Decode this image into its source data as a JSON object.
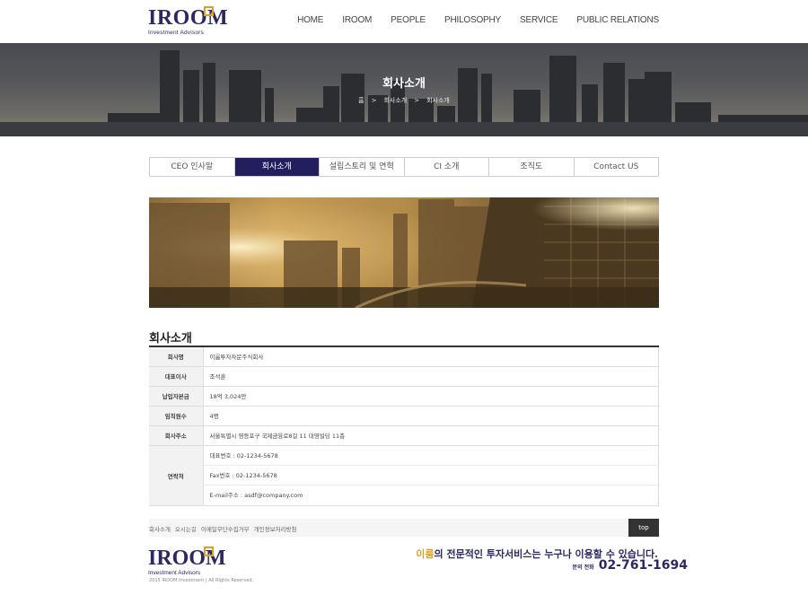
{
  "header": {
    "logo_text": "IROOM",
    "logo_sub": "Investment Advisors",
    "nav": [
      "HOME",
      "IROOM",
      "PEOPLE",
      "PHILOSOPHY",
      "SERVICE",
      "PUBLIC RELATIONS"
    ]
  },
  "hero": {
    "title": "회사소개",
    "breadcrumb": [
      "홈",
      ">",
      "회사소개",
      ">",
      "회사소개"
    ]
  },
  "tabs": [
    "CEO 인사말",
    "회사소개",
    "설립스토리 및 연혁",
    "CI 소개",
    "조직도",
    "Contact US"
  ],
  "active_tab": "회사소개",
  "section_title": "회사소개",
  "info": [
    {
      "k": "회사명",
      "v": "이룸투자자문주식회사"
    },
    {
      "k": "대표이사",
      "v": "조석훈"
    },
    {
      "k": "납입자본금",
      "v": "18억 3,024만"
    },
    {
      "k": "임직원수",
      "v": "4명"
    },
    {
      "k": "회사주소",
      "v": "서울특별시 영등포구 국제금융로8길 11 대영빌딩 11층"
    }
  ],
  "contact": {
    "k": "연락처",
    "lines": [
      "대표번호 : 02-1234-5678",
      "Fax번호 : 02-1234-5678",
      "E-mail주소 : asdf@company.com"
    ]
  },
  "footer": {
    "links": [
      "회사소개",
      "오시는길",
      "이메일무단수집거부",
      "개인정보처리방침"
    ],
    "top_label": "top",
    "logo_text": "IROOM",
    "logo_sub": "Investment Advisors",
    "copyright": "2015 IROOM Investment | All Rights Reserved.",
    "slogan_highlight": "이룸",
    "slogan_rest": "의 전문적인 투자서비스는 누구나 이용할 수 있습니다.",
    "phone_label": "문의 전화",
    "phone": "02-761-1694"
  },
  "colors": {
    "brand_navy": "#231f5e",
    "brand_gold": "#d9a321"
  }
}
